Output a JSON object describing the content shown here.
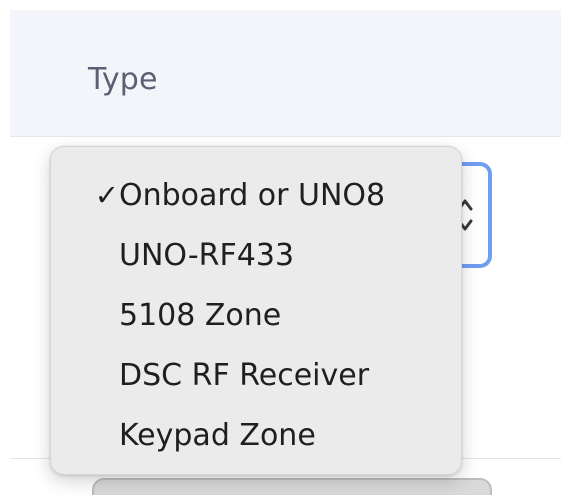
{
  "table": {
    "column_header": "Type"
  },
  "dropdown": {
    "selected_index": 0,
    "check_glyph": "✓",
    "options": [
      "Onboard or UNO8",
      "UNO-RF433",
      "5108 Zone",
      "DSC RF Receiver",
      "Keypad Zone"
    ]
  },
  "colors": {
    "header_bg": "#f3f5fa",
    "menu_bg": "#ebebeb",
    "focus_ring": "#6f9ef0"
  },
  "icons": {
    "selected": "checkmark-icon",
    "stepper": "chevron-up-down-icon"
  }
}
